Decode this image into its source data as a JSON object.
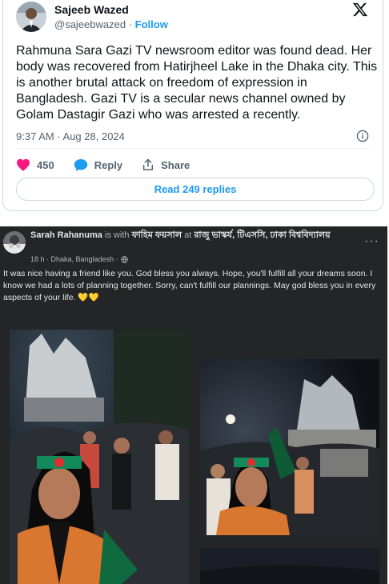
{
  "tweet": {
    "author_name": "Sajeeb Wazed",
    "handle": "@sajeebwazed",
    "separator": " · ",
    "follow_label": "Follow",
    "text": "Rahmuna Sara Gazi TV newsroom editor was found dead. Her body was recovered from Hatirjheel Lake in the Dhaka city. This is another brutal attack on freedom of expression in Bangladesh. Gazi TV is a secular news channel owned by Golam Dastagir Gazi who was arrested a recently.",
    "timestamp": "9:37 AM · Aug 28, 2024",
    "likes": "450",
    "reply_label": "Reply",
    "share_label": "Share",
    "read_replies_label": "Read 249 replies",
    "accent_color": "#1d9bf0",
    "like_color": "#f91880"
  },
  "fb_post": {
    "author": "Sarah Rahanuma",
    "is_with": " is with ",
    "with_person": "ফাহিম ফয়সাল",
    "at": " at ",
    "location_name": "রাজু ভাস্কর্য, টিএসসি, ঢাকা বিশ্ববিদ্যালয়",
    "time_location": "18 h · Dhaka, Bangladesh ·",
    "more_label": "···",
    "body": "It was nice having a friend like you. God bless you always. Hope, you'll fulfill all your dreams soon. I know we had a lots of planning together. Sorry, can't fulfill our plannings. May god bless you in every aspects of your life. 💛💛",
    "background_color": "#242526"
  }
}
